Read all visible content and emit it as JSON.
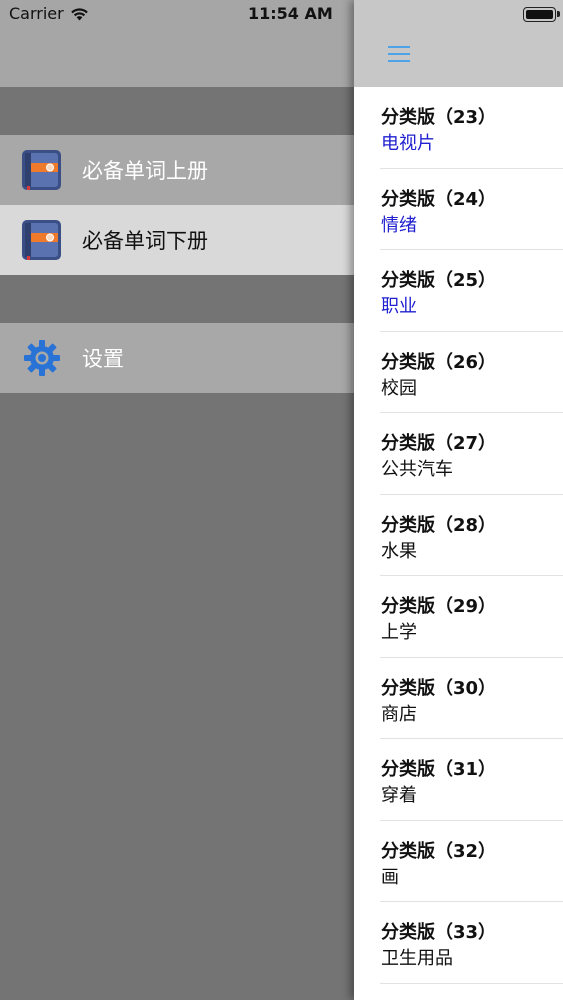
{
  "status": {
    "carrier": "Carrier",
    "time": "11:54 AM"
  },
  "menu": {
    "items": [
      {
        "label": "必备单词上册",
        "icon": "book-icon"
      },
      {
        "label": "必备单词下册",
        "icon": "book-icon"
      },
      {
        "label": "设置",
        "icon": "gear-icon"
      }
    ]
  },
  "panel": {
    "items": [
      {
        "title": "分类版（23）",
        "subtitle": "电视片",
        "subtitle_color": "#2020d0"
      },
      {
        "title": "分类版（24）",
        "subtitle": "情绪",
        "subtitle_color": "#2020d0"
      },
      {
        "title": "分类版（25）",
        "subtitle": "职业",
        "subtitle_color": "#2020d0"
      },
      {
        "title": "分类版（26）",
        "subtitle": "校园",
        "subtitle_color": "#111111"
      },
      {
        "title": "分类版（27）",
        "subtitle": "公共汽车",
        "subtitle_color": "#111111"
      },
      {
        "title": "分类版（28）",
        "subtitle": "水果",
        "subtitle_color": "#111111"
      },
      {
        "title": "分类版（29）",
        "subtitle": "上学",
        "subtitle_color": "#111111"
      },
      {
        "title": "分类版（30）",
        "subtitle": "商店",
        "subtitle_color": "#111111"
      },
      {
        "title": "分类版（31）",
        "subtitle": "穿着",
        "subtitle_color": "#111111"
      },
      {
        "title": "分类版（32）",
        "subtitle": "画",
        "subtitle_color": "#111111"
      },
      {
        "title": "分类版（33）",
        "subtitle": "卫生用品",
        "subtitle_color": "#111111"
      }
    ]
  }
}
